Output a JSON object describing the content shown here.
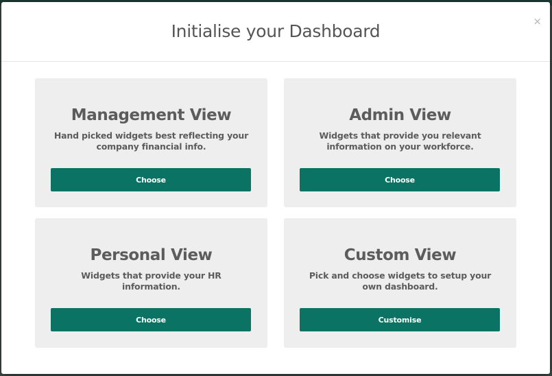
{
  "modal": {
    "title": "Initialise your Dashboard",
    "close_label": "×"
  },
  "cards": [
    {
      "title": "Management View",
      "description": "Hand picked widgets best reflecting your company financial info.",
      "button_label": "Choose"
    },
    {
      "title": "Admin View",
      "description": "Widgets that provide you relevant information on your workforce.",
      "button_label": "Choose"
    },
    {
      "title": "Personal View",
      "description": "Widgets that provide your HR information.",
      "button_label": "Choose"
    },
    {
      "title": "Custom View",
      "description": "Pick and choose widgets to setup your own dashboard.",
      "button_label": "Customise"
    }
  ],
  "colors": {
    "accent": "#0b7364",
    "card_background": "#eeeeee",
    "title_text": "#5c5c5c"
  }
}
